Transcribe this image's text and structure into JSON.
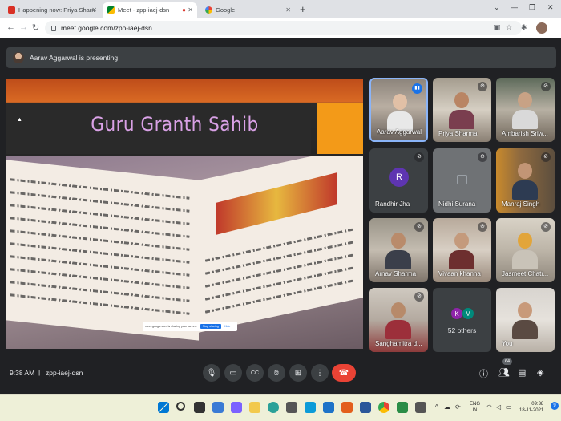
{
  "browser": {
    "tabs": [
      {
        "title": "Happening now: Priya Sharma is",
        "active": false
      },
      {
        "title": "Meet - zpp-iaej-dsn",
        "active": true
      },
      {
        "title": "Google",
        "active": false
      }
    ],
    "url": "meet.google.com/zpp-iaej-dsn"
  },
  "meet": {
    "presenter_text": "Aarav Aggarwal is presenting",
    "slide_title": "Guru Granth Sahib",
    "share_notice": {
      "message": "meet.google.com is sharing your screen.",
      "stop_label": "Stop sharing",
      "hide_label": "Hide"
    },
    "participants": [
      {
        "name": "Aarav Aggarwal"
      },
      {
        "name": "Priya Sharma"
      },
      {
        "name": "Ambarish Sriw..."
      },
      {
        "name": "Randhir Jha",
        "initial": "R"
      },
      {
        "name": "Nidhi Surana"
      },
      {
        "name": "Manraj Singh"
      },
      {
        "name": "Arnav Sharma"
      },
      {
        "name": "Vivaan khanna"
      },
      {
        "name": "Jasmeet Chatr..."
      },
      {
        "name": "Sanghamitra d..."
      },
      {
        "name": "You"
      }
    ],
    "others": {
      "label": "52 others",
      "initials": [
        "K",
        "M"
      ]
    },
    "time": "9:38 AM",
    "separator": "|",
    "meeting_code": "zpp-iaej-dsn",
    "people_count": "64"
  },
  "taskbar": {
    "lang_top": "ENG",
    "lang_bottom": "IN",
    "time": "09:38",
    "date": "18-11-2021"
  },
  "colors": {
    "meet_bg": "#202124",
    "tile_bg": "#3c4043",
    "hangup": "#ea4335",
    "accent": "#1a73e8",
    "slide_title": "#d9a1e6",
    "slide_orange": "#f39a18"
  }
}
